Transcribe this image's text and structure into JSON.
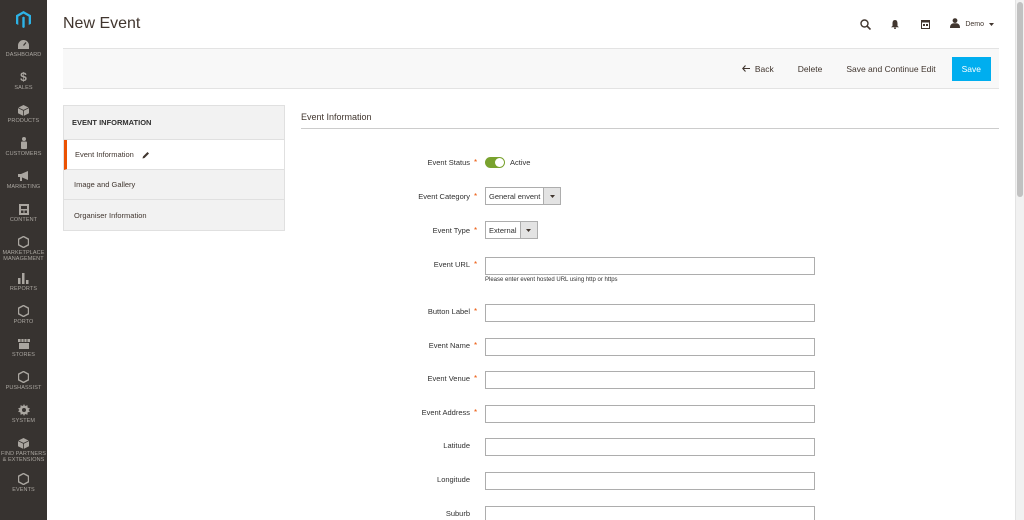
{
  "page": {
    "title": "New Event"
  },
  "header": {
    "user_name": "Demo"
  },
  "sidebar": {
    "items": [
      {
        "label": "DASHBOARD",
        "icon": "dashboard-icon"
      },
      {
        "label": "SALES",
        "icon": "dollar-icon"
      },
      {
        "label": "PRODUCTS",
        "icon": "cube-icon"
      },
      {
        "label": "CUSTOMERS",
        "icon": "person-icon"
      },
      {
        "label": "MARKETING",
        "icon": "megaphone-icon"
      },
      {
        "label": "CONTENT",
        "icon": "content-icon"
      },
      {
        "label_1": "MARKETPLACE",
        "label_2": "MANAGEMENT",
        "icon": "hexagon-icon"
      },
      {
        "label": "REPORTS",
        "icon": "bar-chart-icon"
      },
      {
        "label": "PORTO",
        "icon": "hexagon-icon"
      },
      {
        "label": "STORES",
        "icon": "store-icon"
      },
      {
        "label": "PUSHASSIST",
        "icon": "hexagon-icon"
      },
      {
        "label": "SYSTEM",
        "icon": "gear-icon"
      },
      {
        "label_1": "FIND PARTNERS",
        "label_2": "& EXTENSIONS",
        "icon": "partners-icon"
      },
      {
        "label": "EVENTS",
        "icon": "hexagon-icon"
      }
    ]
  },
  "actions": {
    "back": "Back",
    "delete": "Delete",
    "save_continue": "Save and Continue Edit",
    "save": "Save"
  },
  "tabs": {
    "title": "EVENT INFORMATION",
    "items": [
      {
        "label": "Event Information"
      },
      {
        "label": "Image and Gallery"
      },
      {
        "label": "Organiser Information"
      }
    ]
  },
  "form": {
    "section_title": "Event Information",
    "event_status": {
      "label": "Event Status",
      "value": "Active"
    },
    "event_category": {
      "label": "Event Category",
      "value": "General envent"
    },
    "event_type": {
      "label": "Event Type",
      "value": "External"
    },
    "event_url": {
      "label": "Event URL",
      "note": "Please enter event hosted URL using http or https"
    },
    "button_label": {
      "label": "Button Label"
    },
    "event_name": {
      "label": "Event Name"
    },
    "event_venue": {
      "label": "Event Venue"
    },
    "event_address": {
      "label": "Event Address"
    },
    "latitude": {
      "label": "Latitude"
    },
    "longitude": {
      "label": "Longitude"
    },
    "suburb": {
      "label": "Suburb"
    }
  },
  "colors": {
    "sidebar_bg": "#373330",
    "primary": "#00aeef",
    "accent": "#eb5202",
    "toggle_on": "#79a22e"
  }
}
